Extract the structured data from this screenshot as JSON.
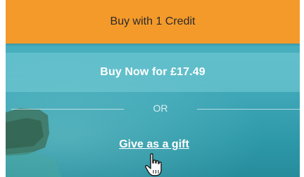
{
  "actions": {
    "buy_credit_label": "Buy with 1 Credit",
    "buy_now_label": "Buy Now for £17.49",
    "or_label": "OR",
    "gift_label": "Give as a gift"
  },
  "colors": {
    "credit_button": "#f49a2b",
    "panel_background": "#46aebd",
    "text_light": "#ffffff"
  },
  "icons": {
    "cursor": "hand-pointer-icon"
  }
}
